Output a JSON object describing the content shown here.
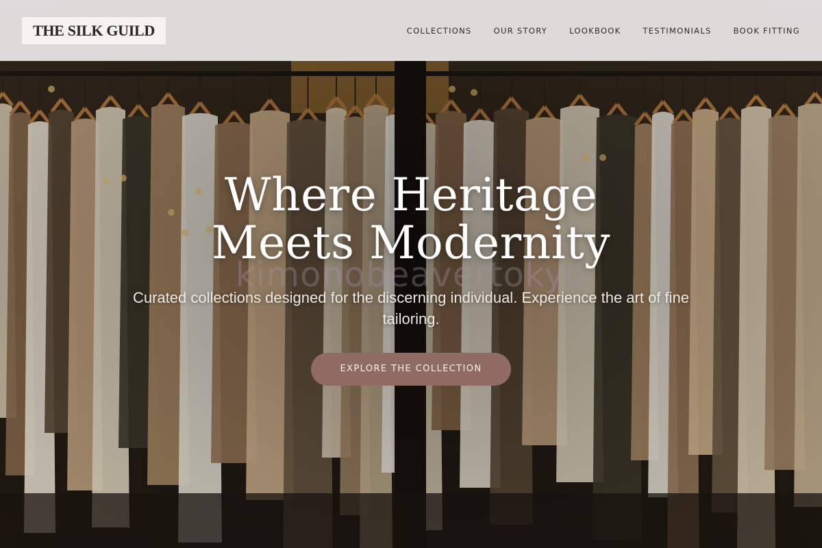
{
  "header": {
    "logo": "THE SILK GUILD",
    "nav": [
      {
        "label": "COLLECTIONS"
      },
      {
        "label": "OUR STORY"
      },
      {
        "label": "LOOKBOOK"
      },
      {
        "label": "TESTIMONIALS"
      },
      {
        "label": "BOOK FITTING"
      }
    ]
  },
  "hero": {
    "title": "Where Heritage Meets Modernity",
    "subtitle": "Curated collections designed for the discerning individual. Experience the art of fine tailoring.",
    "cta_label": "EXPLORE THE COLLECTION",
    "watermark": "kimonobeavertokyo",
    "image": "clothing-rack-photo"
  },
  "colors": {
    "header_bg": "#ebe9e9",
    "cta_bg": "#8f6b63",
    "text_light": "#ffffff"
  }
}
